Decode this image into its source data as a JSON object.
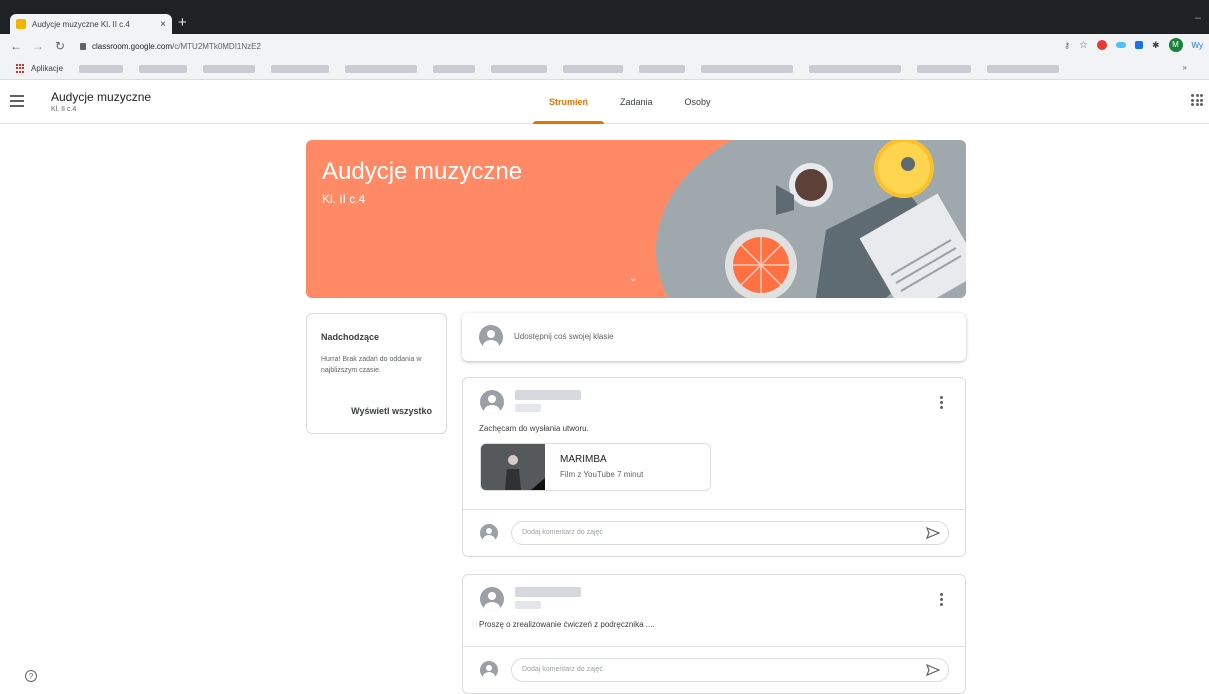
{
  "browser": {
    "tab_title": "Audycje muzyczne Kl. II c.4",
    "tab_close": "×",
    "new_tab": "+",
    "url_host": "classroom.google.com",
    "url_path": "/c/MTU2MTk0MDI1NzE2",
    "bookmarks_label": "Aplikacje",
    "profile_initial": "M",
    "profile_text": "Wy",
    "bookmarks_more": "»"
  },
  "header": {
    "class_name": "Audycje muzyczne",
    "class_section": "Kl. II c.4",
    "tabs": [
      {
        "label": "Strumień",
        "active": true
      },
      {
        "label": "Zadania",
        "active": false
      },
      {
        "label": "Osoby",
        "active": false
      }
    ]
  },
  "banner": {
    "title": "Audycje muzyczne",
    "subtitle": "Kl. II c.4",
    "color": "#ff8a65"
  },
  "upcoming": {
    "title": "Nadchodzące",
    "message": "Hurra! Brak zadań do oddania w najbliższym czasie.",
    "link": "Wyświetl wszystko"
  },
  "share": {
    "placeholder": "Udostępnij coś swojej klasie"
  },
  "posts": [
    {
      "text": "Zachęcam do wysłania utworu.",
      "attachment": {
        "title": "MARIMBA",
        "meta": "Film z YouTube   7 minut"
      },
      "comment_placeholder": "Dodaj komentarz do zajęć"
    },
    {
      "text": "Proszę o zrealizowanie ćwiczeń z podręcznika ....",
      "comment_placeholder": "Dodaj komentarz do zajęć"
    }
  ],
  "colors": {
    "accent": "#e37400",
    "banner": "#ff8a65"
  }
}
